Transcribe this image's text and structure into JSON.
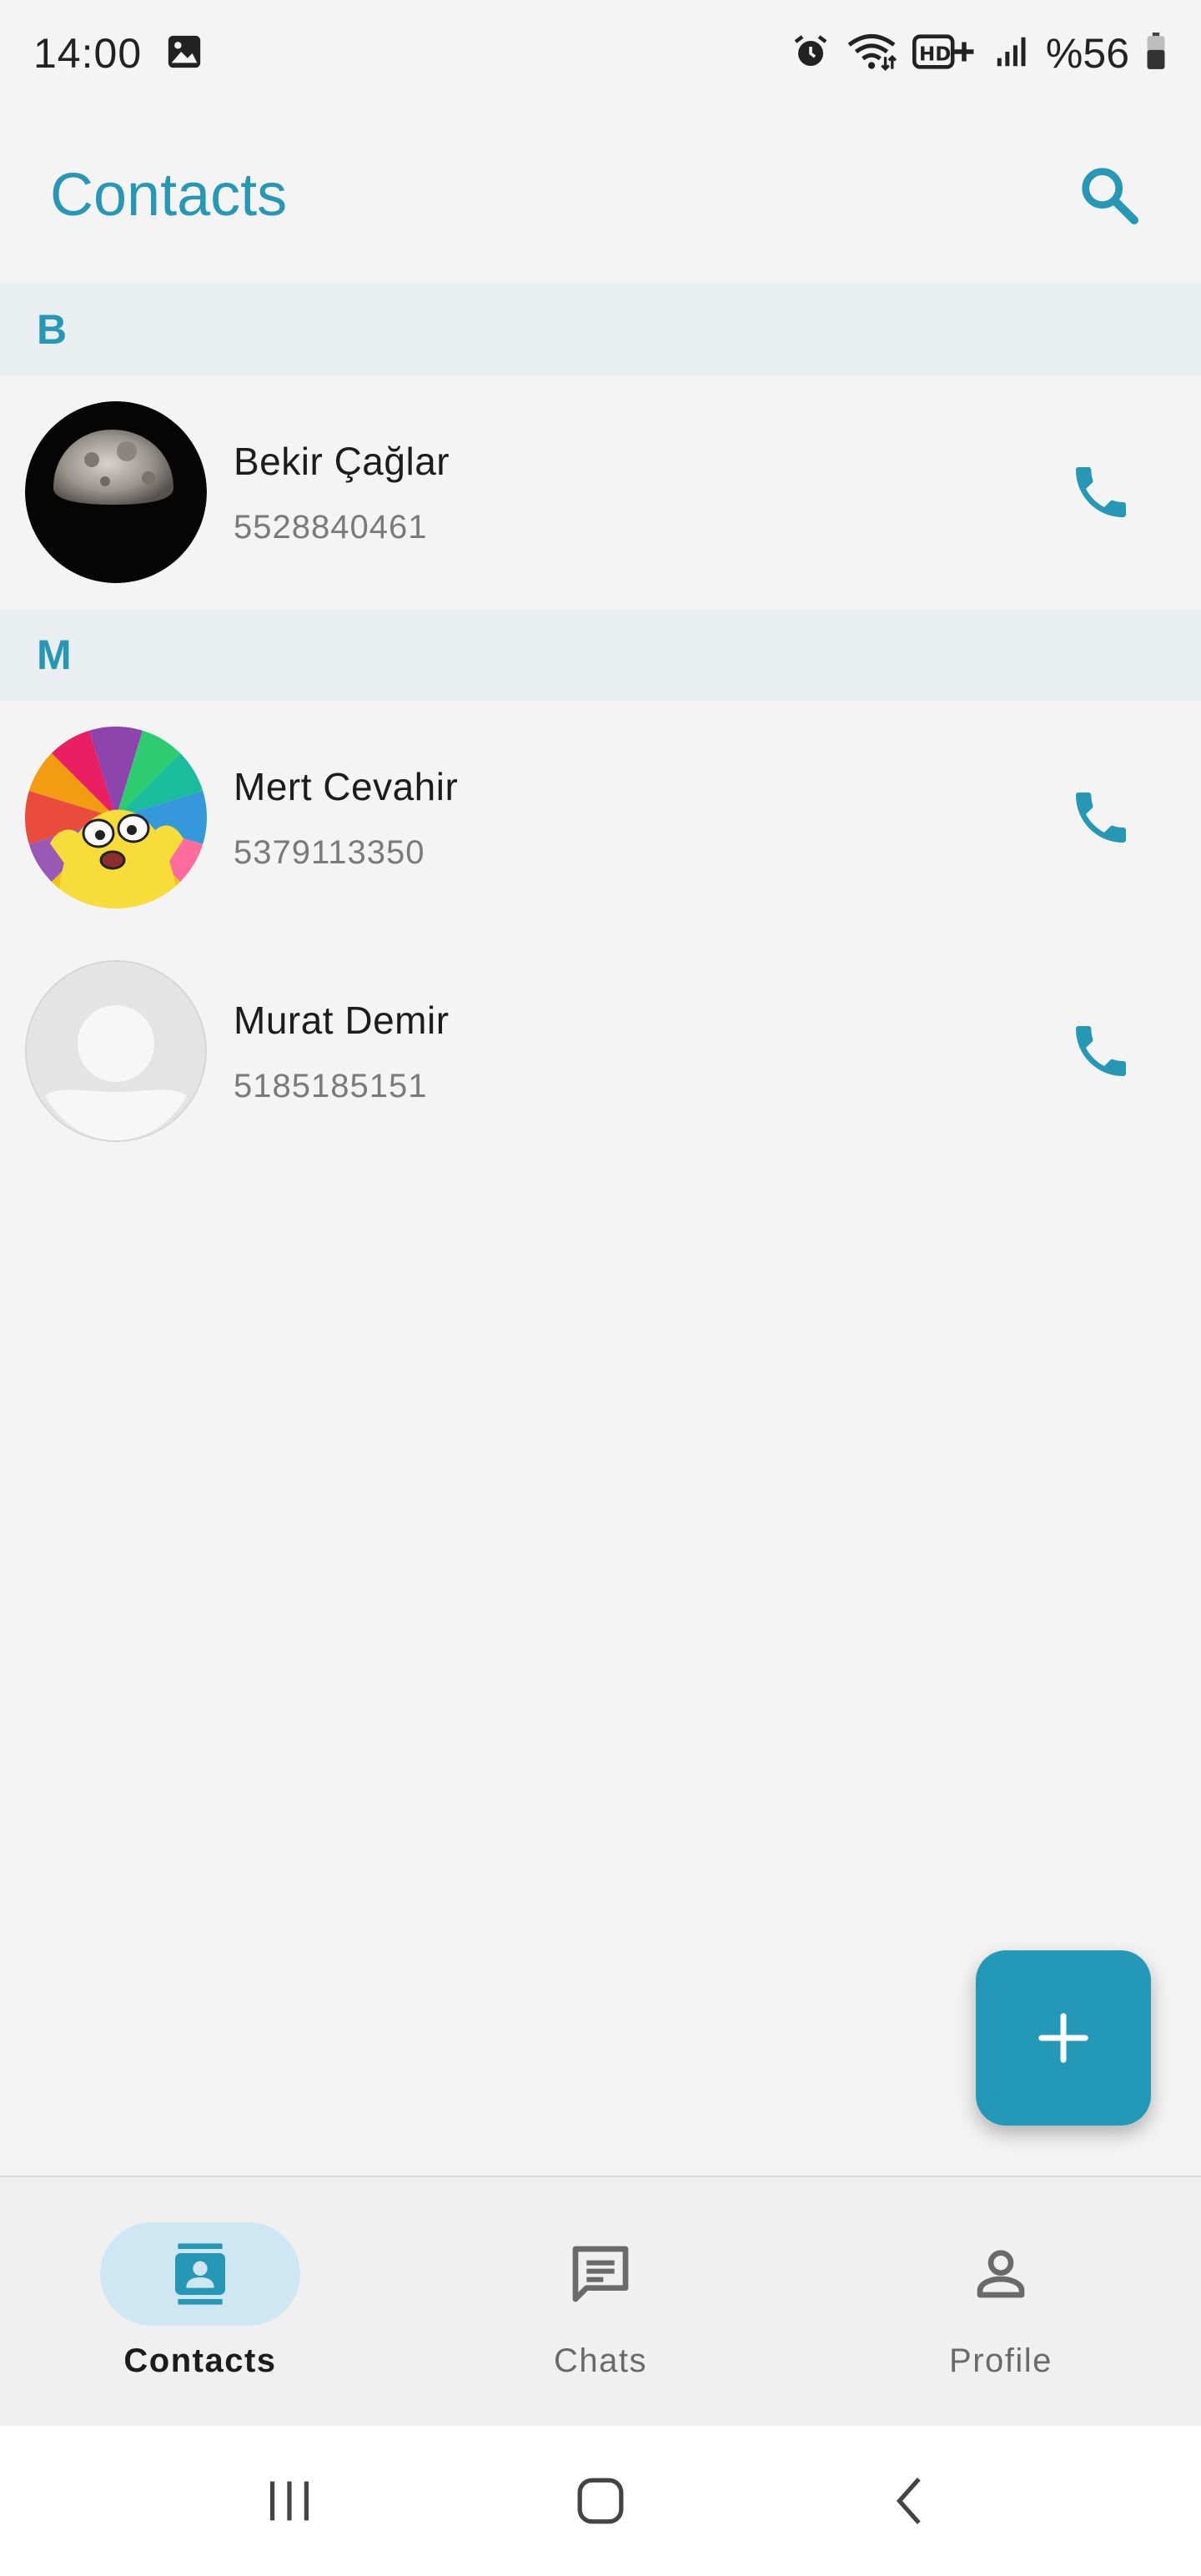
{
  "status_bar": {
    "time": "14:00",
    "battery": "%56",
    "icons": [
      "image-icon",
      "alarm-icon",
      "wifi-icon",
      "hd-plus-icon",
      "signal-icon",
      "battery-icon"
    ]
  },
  "header": {
    "title": "Contacts",
    "search_icon": "search-icon"
  },
  "sections": [
    {
      "letter": "B",
      "contacts": [
        {
          "name": "Bekir Çağlar",
          "phone": "5528840461",
          "avatar": "moon-photo"
        }
      ]
    },
    {
      "letter": "M",
      "contacts": [
        {
          "name": "Mert Cevahir",
          "phone": "5379113350",
          "avatar": "cartoon-rainbow"
        },
        {
          "name": "Murat Demir",
          "phone": "5185185151",
          "avatar": "default-person"
        }
      ]
    }
  ],
  "fab": {
    "icon": "plus-icon"
  },
  "bottom_nav": {
    "items": [
      {
        "label": "Contacts",
        "icon": "contacts-icon",
        "active": true
      },
      {
        "label": "Chats",
        "icon": "chat-icon",
        "active": false
      },
      {
        "label": "Profile",
        "icon": "person-icon",
        "active": false
      }
    ]
  },
  "colors": {
    "accent": "#2697b5",
    "section_bg": "#e9eef1",
    "background": "#f4f4f4",
    "nav_active_pill": "#cfe7f2"
  }
}
